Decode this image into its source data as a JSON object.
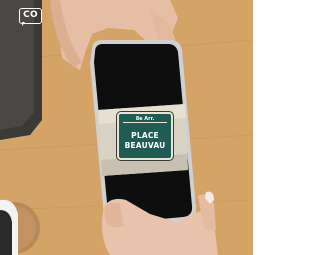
{
  "watermark": {
    "text": "CO"
  },
  "sign": {
    "arrondissement": "8e Arr.",
    "line1": "PLACE",
    "line2": "BEAUVAU"
  },
  "colors": {
    "table_wood": "#d9a86a",
    "sign_green": "#1f5c54",
    "phone_body": "#111111",
    "skin": "#e8c2aa"
  }
}
